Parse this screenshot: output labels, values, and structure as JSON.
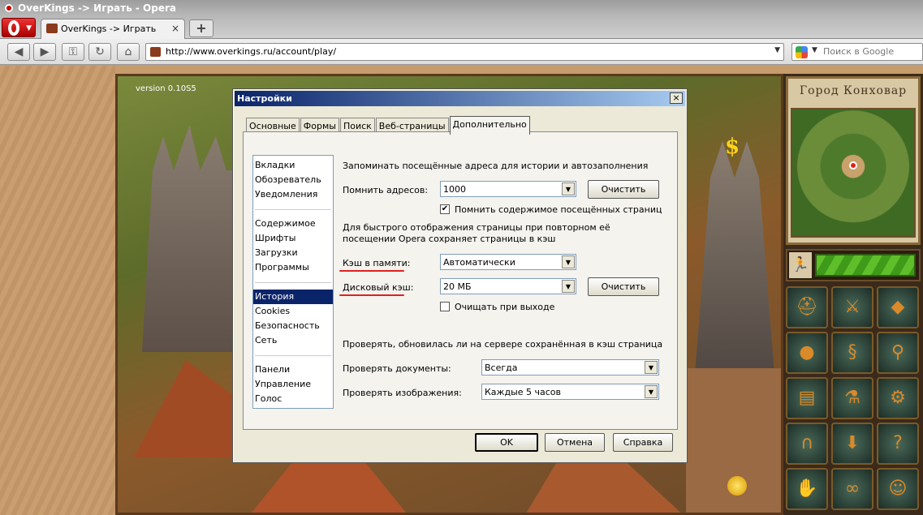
{
  "window": {
    "title": "OverKings -> Играть - Opera"
  },
  "tabs": [
    {
      "label": "OverKings -> Играть",
      "close_symbol": "×"
    }
  ],
  "new_tab_symbol": "+",
  "address": {
    "url": "http://www.overkings.ru/account/play/"
  },
  "search": {
    "placeholder": "Поиск в Google"
  },
  "game": {
    "version": "version 0.10S5",
    "city_name": "Город Конховар"
  },
  "dialog": {
    "title": "Настройки",
    "close_symbol": "×",
    "tabs": [
      "Основные",
      "Формы",
      "Поиск",
      "Веб-страницы",
      "Дополнительно"
    ],
    "active_tab": "Дополнительно",
    "categories": {
      "group1": [
        "Вкладки",
        "Обозреватель",
        "Уведомления"
      ],
      "group2": [
        "Содержимое",
        "Шрифты",
        "Загрузки",
        "Программы"
      ],
      "group3": [
        "История",
        "Cookies",
        "Безопасность",
        "Сеть"
      ],
      "group4": [
        "Панели",
        "Управление",
        "Голос"
      ]
    },
    "selected_category": "История",
    "history": {
      "section_label": "Запоминать посещённые адреса для истории и автозаполнения",
      "remember_label": "Помнить адресов:",
      "remember_value": "1000",
      "clear_label": "Очистить",
      "remember_content_label": "Помнить содержимое посещённых страниц",
      "remember_content_checked": true,
      "cache_note_line1": "Для быстрого отображения страницы при повторном её",
      "cache_note_line2": "посещении Opera сохраняет страницы в кэш",
      "mem_cache_label": "Кэш в памяти:",
      "mem_cache_value": "Автоматически",
      "disk_cache_label": "Дисковый кэш:",
      "disk_cache_value": "20 МБ",
      "disk_clear_label": "Очистить",
      "clear_on_exit_label": "Очищать при выходе",
      "clear_on_exit_checked": false,
      "check_note": "Проверять, обновилась ли на сервере сохранённая в кэш страница",
      "check_docs_label": "Проверять документы:",
      "check_docs_value": "Всегда",
      "check_images_label": "Проверять изображения:",
      "check_images_value": "Каждые 5 часов"
    },
    "buttons": {
      "ok": "OK",
      "cancel": "Отмена",
      "help": "Справка"
    }
  },
  "colors": {
    "dialog_title": "#0a246a",
    "selection": "#0a246a",
    "annotation": "#e02020"
  }
}
